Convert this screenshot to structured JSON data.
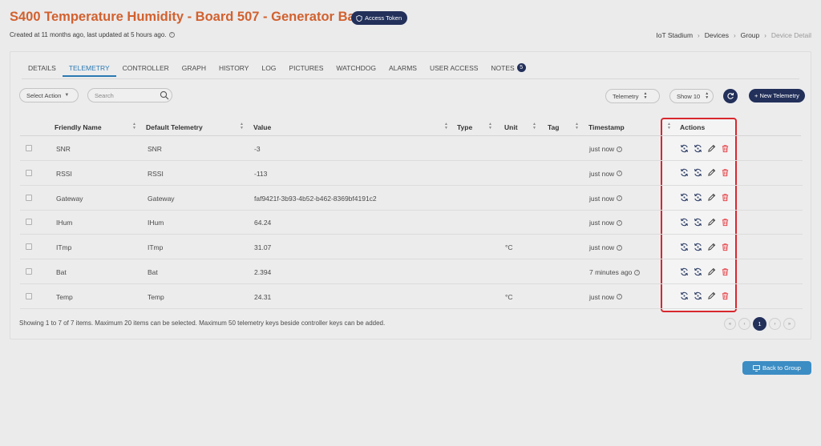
{
  "header": {
    "title": "S400 Temperature Humidity - Board 507 - Generator Battery",
    "access_token_label": "Access Token",
    "subtitle": "Created at 11 months ago, last updated at 5 hours ago."
  },
  "breadcrumb": [
    "IoT Stadium",
    "Devices",
    "Group",
    "Device Detail"
  ],
  "tabs": [
    {
      "label": "DETAILS"
    },
    {
      "label": "TELEMETRY",
      "active": true
    },
    {
      "label": "CONTROLLER"
    },
    {
      "label": "GRAPH"
    },
    {
      "label": "HISTORY"
    },
    {
      "label": "LOG"
    },
    {
      "label": "PICTURES"
    },
    {
      "label": "WATCHDOG"
    },
    {
      "label": "ALARMS"
    },
    {
      "label": "USER ACCESS"
    },
    {
      "label": "NOTES",
      "badge": "5"
    }
  ],
  "toolbar": {
    "select_action": "Select Action",
    "search_placeholder": "Search",
    "type_filter": "Telemetry",
    "show_count": "Show 10",
    "new_button": "+ New Telemetry"
  },
  "table": {
    "columns": {
      "friendly_name": "Friendly Name",
      "default_telemetry": "Default Telemetry",
      "value": "Value",
      "type": "Type",
      "unit": "Unit",
      "tag": "Tag",
      "timestamp": "Timestamp",
      "actions": "Actions"
    },
    "rows": [
      {
        "friendly": "SNR",
        "default": "SNR",
        "value": "-3",
        "type": "",
        "unit": "",
        "tag": "",
        "timestamp": "just now"
      },
      {
        "friendly": "RSSI",
        "default": "RSSI",
        "value": "-113",
        "type": "",
        "unit": "",
        "tag": "",
        "timestamp": "just now"
      },
      {
        "friendly": "Gateway",
        "default": "Gateway",
        "value": "faf9421f-3b93-4b52-b462-8369bf4191c2",
        "type": "",
        "unit": "",
        "tag": "",
        "timestamp": "just now"
      },
      {
        "friendly": "IHum",
        "default": "IHum",
        "value": "64.24",
        "type": "",
        "unit": "",
        "tag": "",
        "timestamp": "just now"
      },
      {
        "friendly": "ITmp",
        "default": "ITmp",
        "value": "31.07",
        "type": "",
        "unit": "°C",
        "tag": "",
        "timestamp": "just now"
      },
      {
        "friendly": "Bat",
        "default": "Bat",
        "value": "2.394",
        "type": "",
        "unit": "",
        "tag": "",
        "timestamp": "7 minutes ago"
      },
      {
        "friendly": "Temp",
        "default": "Temp",
        "value": "24.31",
        "type": "",
        "unit": "°C",
        "tag": "",
        "timestamp": "just now"
      }
    ]
  },
  "footer": {
    "info": "Showing 1 to 7 of 7 items. Maximum 20 items can be selected. Maximum 50 telemetry keys beside controller keys can be added.",
    "current_page": "1",
    "pager_first": "«",
    "pager_prev": "‹",
    "pager_next": "›",
    "pager_last": "»"
  },
  "back_button": "Back to Group",
  "colors": {
    "title": "#d2612e",
    "navy": "#22305a",
    "accent": "#2b7ab3",
    "highlight": "#d8272d",
    "delete": "#e5484d"
  }
}
